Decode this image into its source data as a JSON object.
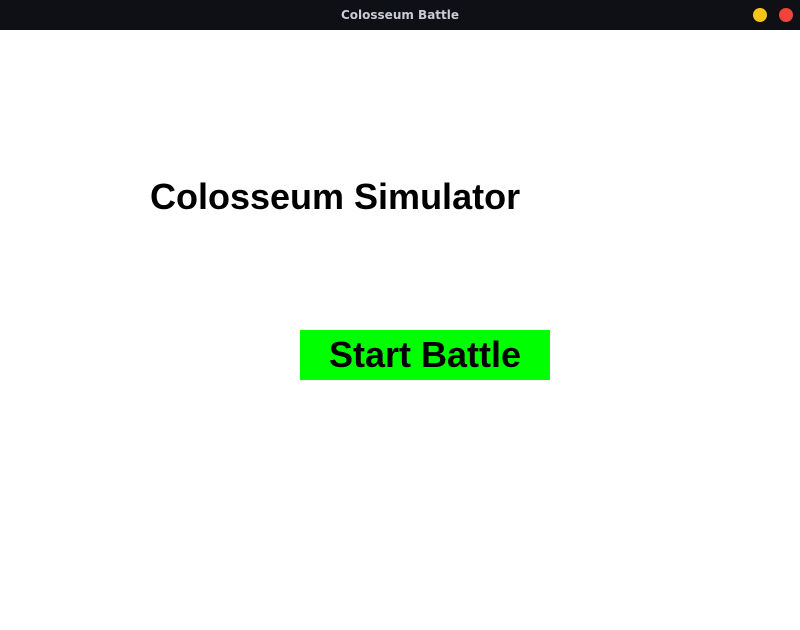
{
  "window": {
    "title": "Colosseum Battle"
  },
  "main": {
    "heading": "Colosseum Simulator",
    "start_button_label": "Start Battle"
  },
  "colors": {
    "titlebar_bg": "#0e1016",
    "minimize_button": "#f5c516",
    "close_button": "#f0433a",
    "start_button_bg": "#00ff00",
    "background": "#ffffff",
    "text": "#000000"
  },
  "icons": {
    "minimize": "minimize-icon",
    "close": "close-icon"
  }
}
